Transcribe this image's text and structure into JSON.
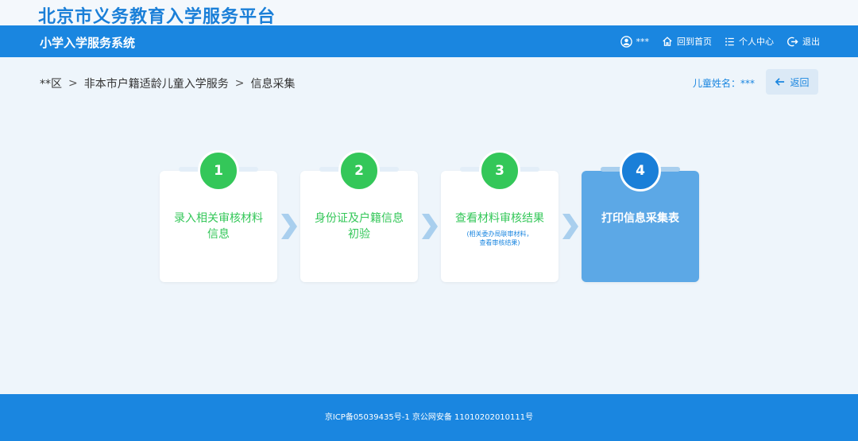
{
  "header": {
    "platform_title": "北京市义务教育入学服务平台",
    "system_name": "小学入学服务系统",
    "user_name": "***",
    "home_label": "回到首页",
    "profile_label": "个人中心",
    "logout_label": "退出"
  },
  "breadcrumb": {
    "items": [
      "**区",
      "非本市户籍适龄儿童入学服务",
      "信息采集"
    ],
    "separator": ">"
  },
  "child": {
    "label": "儿童姓名：***"
  },
  "back_button": {
    "label": "返回"
  },
  "steps": [
    {
      "number": "1",
      "title_line1": "录入相关审核材料",
      "title_line2": "信息",
      "status": "done"
    },
    {
      "number": "2",
      "title_line1": "身份证及户籍信息",
      "title_line2": "初验",
      "status": "done"
    },
    {
      "number": "3",
      "title_line1": "查看材料审核结果",
      "sub_line1": "(相关委办局联审材料，",
      "sub_line2": "查看审核结果)",
      "status": "done"
    },
    {
      "number": "4",
      "title_line1": "打印信息采集表",
      "status": "active"
    }
  ],
  "colors": {
    "brand_blue": "#1a86e0",
    "done_green": "#34c759",
    "active_card": "#5ca8e6"
  },
  "footer": {
    "text": "京ICP备05039435号-1 京公网安备 11010202010111号"
  }
}
